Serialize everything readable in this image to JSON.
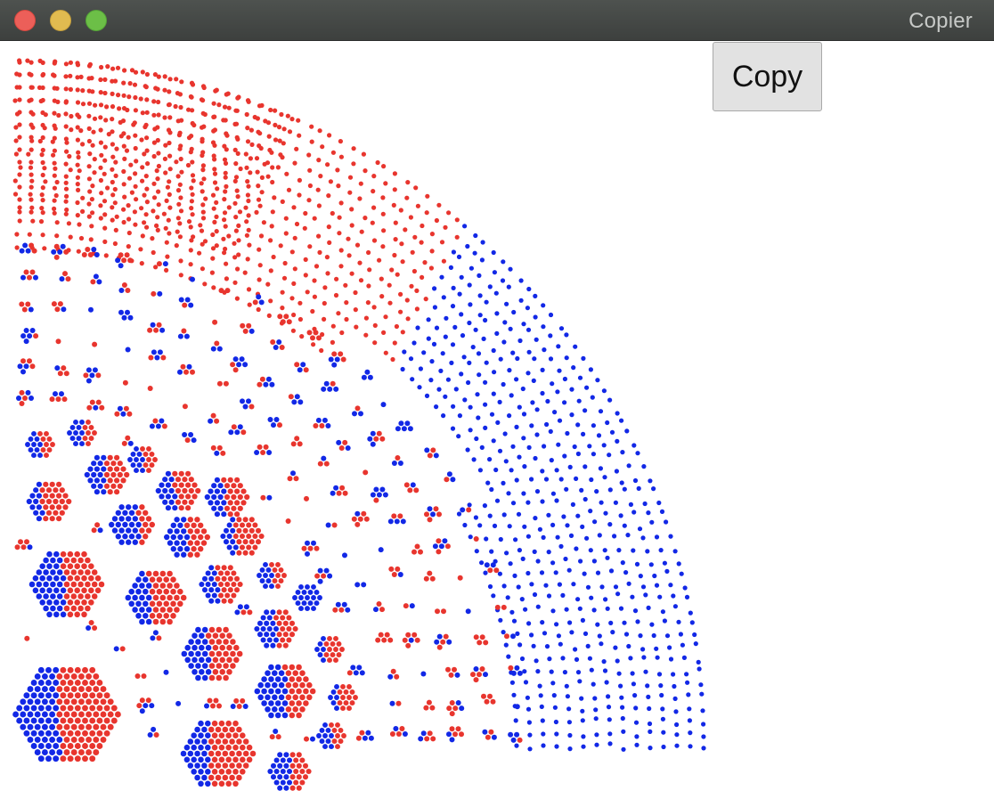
{
  "window": {
    "title": "Copier"
  },
  "toolbar": {
    "copy_label": "Copy"
  },
  "colors": {
    "red": "#e8352e",
    "blue": "#1228e6",
    "titlebar": "#444846",
    "close": "#ec5f59",
    "minimize": "#e1bb50",
    "maximize": "#6cbf47"
  }
}
